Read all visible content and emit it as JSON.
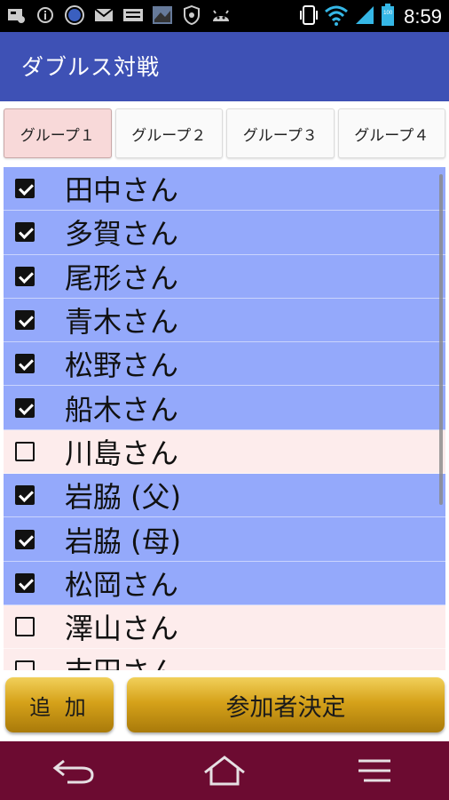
{
  "status_bar": {
    "time": "8:59",
    "battery_level": "100",
    "left_icons": [
      "debug-icon",
      "info-icon",
      "battery-badge-icon",
      "mail-icon",
      "keyboard-icon",
      "photo-icon",
      "shield-icon",
      "android-icon"
    ],
    "right_icons": [
      "vibrate-icon",
      "wifi-icon",
      "signal-icon",
      "battery-icon"
    ]
  },
  "app": {
    "title": "ダブルス対戦",
    "bar_color": "#3e51b5"
  },
  "tabs": [
    {
      "label": "グループ１",
      "active": true
    },
    {
      "label": "グループ２",
      "active": false
    },
    {
      "label": "グループ３",
      "active": false
    },
    {
      "label": "グループ４",
      "active": false
    }
  ],
  "players": [
    {
      "name": "田中さん",
      "checked": true
    },
    {
      "name": "多賀さん",
      "checked": true
    },
    {
      "name": "尾形さん",
      "checked": true
    },
    {
      "name": "青木さん",
      "checked": true
    },
    {
      "name": "松野さん",
      "checked": true
    },
    {
      "name": "船木さん",
      "checked": true
    },
    {
      "name": "川島さん",
      "checked": false
    },
    {
      "name": "岩脇 (父)",
      "checked": true
    },
    {
      "name": "岩脇 (母)",
      "checked": true
    },
    {
      "name": "松岡さん",
      "checked": true
    },
    {
      "name": "澤山さん",
      "checked": false
    },
    {
      "name": "吉田さん",
      "checked": false
    }
  ],
  "buttons": {
    "add": "追 加",
    "decide": "参加者決定"
  },
  "colors": {
    "checked_row": "#94a9fb",
    "unchecked_row": "#fdecec",
    "nav_bar": "#6c0b31",
    "button_gold": "#d6a21a"
  },
  "nav": {
    "back": "back-icon",
    "home": "home-icon",
    "menu": "menu-icon"
  }
}
